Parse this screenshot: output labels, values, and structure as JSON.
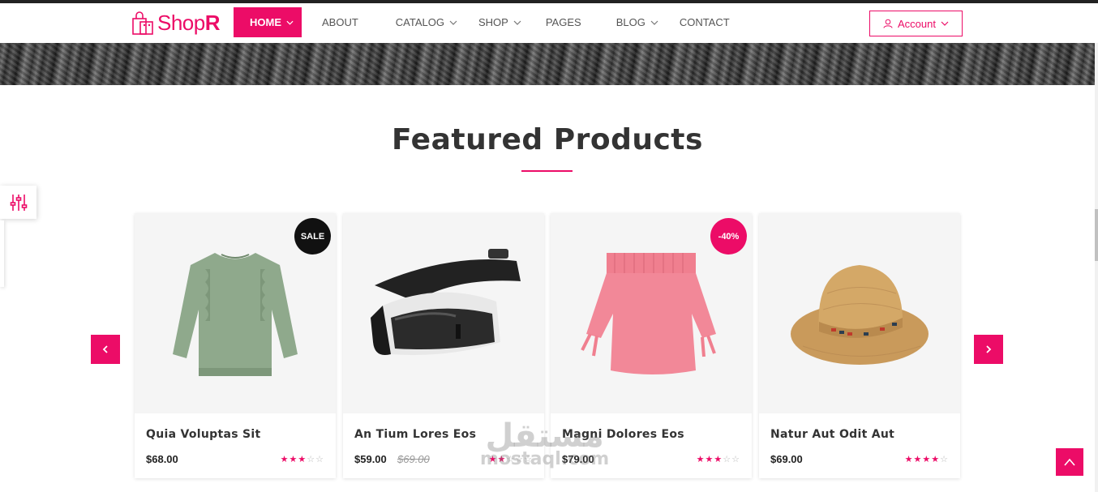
{
  "brand": {
    "name_light": "Shop",
    "name_bold": "R",
    "accent": "#ec0c67"
  },
  "nav": {
    "items": [
      {
        "label": "HOME",
        "active": true,
        "has_dropdown": true
      },
      {
        "label": "ABOUT",
        "active": false,
        "has_dropdown": false
      },
      {
        "label": "CATALOG",
        "active": false,
        "has_dropdown": true
      },
      {
        "label": "SHOP",
        "active": false,
        "has_dropdown": true
      },
      {
        "label": "PAGES",
        "active": false,
        "has_dropdown": false
      },
      {
        "label": "BLOG",
        "active": false,
        "has_dropdown": true
      },
      {
        "label": "CONTACT",
        "active": false,
        "has_dropdown": false
      }
    ]
  },
  "account": {
    "label": "Account",
    "icon": "user-icon"
  },
  "section": {
    "title": "Featured Products"
  },
  "products": [
    {
      "name": "Quia Voluptas Sit",
      "price": "$68.00",
      "old_price": "",
      "rating": 3,
      "badge": "SALE",
      "image": "green-ruffle-blouse"
    },
    {
      "name": "An Tium Lores Eos",
      "price": "$59.00",
      "old_price": "$69.00",
      "rating": 2,
      "badge": "",
      "image": "vr-headset"
    },
    {
      "name": "Magni Dolores Eos",
      "price": "$79.00",
      "old_price": "",
      "rating": 3,
      "badge": "-40%",
      "image": "pink-off-shoulder-top"
    },
    {
      "name": "Natur Aut Odit Aut",
      "price": "$69.00",
      "old_price": "",
      "rating": 4,
      "badge": "",
      "image": "straw-fedora-hat"
    }
  ],
  "watermark": {
    "arabic": "مستقل",
    "latin": "mostaql.com"
  },
  "icons": {
    "filter": "sliders-icon",
    "prev": "chevron-left-icon",
    "next": "chevron-right-icon",
    "back_to_top": "arrow-up-icon"
  }
}
